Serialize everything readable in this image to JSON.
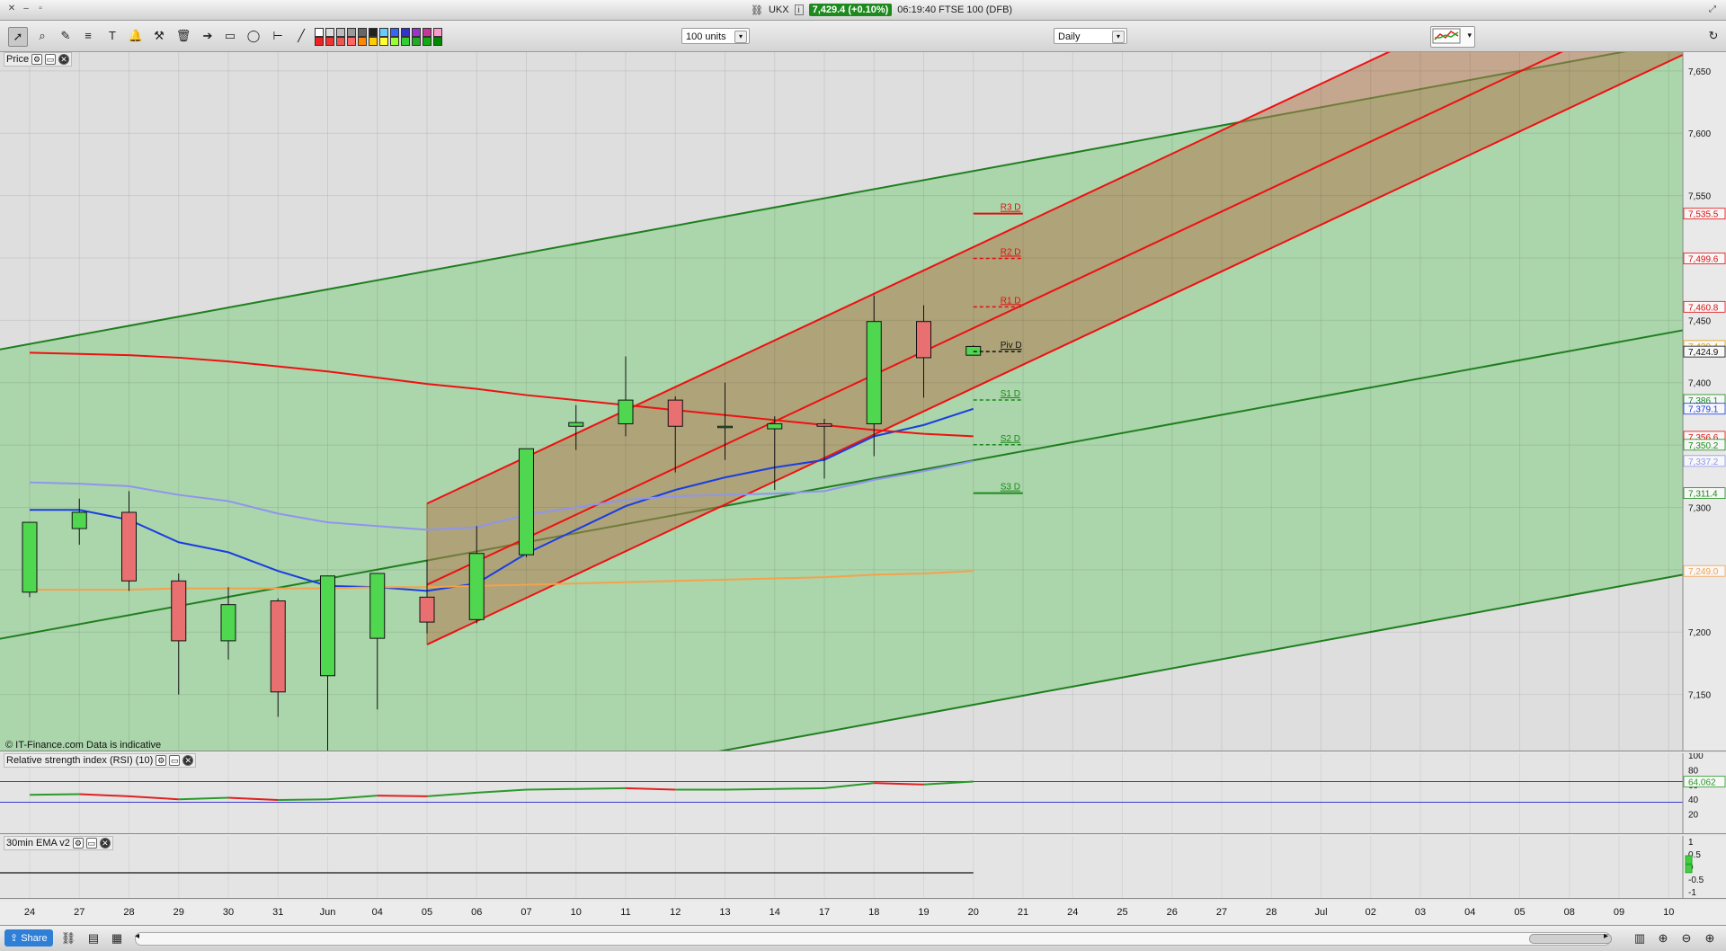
{
  "window": {
    "symbol": "UKX",
    "price_badge": "7,429.4 (+0.10%)",
    "time_and_market": "06:19:40 FTSE 100 (DFB)"
  },
  "toolbar": {
    "units_select": "100 units",
    "interval_select": "Daily"
  },
  "panels": {
    "price_label": "Price",
    "rsi_label": "Relative strength index (RSI) (10)",
    "ema_label": "30min EMA v2",
    "credit": "© IT-Finance.com  Data is indicative"
  },
  "statusbar": {
    "share_label": "Share"
  },
  "colors": {
    "green_channel": "#1f7f1f",
    "red_channel": "#ee1111",
    "ma_blue": "#1a3ee0",
    "ma_lightblue": "#8f95ee",
    "ma_orange": "#f5a24a",
    "up_candle": "#4fd84f",
    "down_candle": "#e87070"
  },
  "chart_data": [
    {
      "type": "candlestick",
      "x_axis_labels": [
        "24",
        "27",
        "28",
        "29",
        "30",
        "31",
        "Jun",
        "04",
        "05",
        "06",
        "07",
        "10",
        "11",
        "12",
        "13",
        "14",
        "17",
        "18",
        "19",
        "20",
        "21",
        "24",
        "25",
        "26",
        "27",
        "28",
        "Jul",
        "02",
        "03",
        "04",
        "05",
        "08",
        "09",
        "10"
      ],
      "y_ticks": [
        "7,650",
        "7,600",
        "7,550",
        "7,500",
        "7,450",
        "7,400",
        "7,350",
        "7,300",
        "7,250",
        "7,200",
        "7,150"
      ],
      "ylim": [
        7105,
        7665
      ],
      "candles": [
        {
          "date": "24",
          "open": 7232,
          "high": 7282,
          "low": 7228,
          "close": 7288
        },
        {
          "date": "27",
          "open": 7283,
          "high": 7307,
          "low": 7270,
          "close": 7296
        },
        {
          "date": "28",
          "open": 7296,
          "high": 7313,
          "low": 7233,
          "close": 7241
        },
        {
          "date": "29",
          "open": 7241,
          "high": 7247,
          "low": 7150,
          "close": 7193
        },
        {
          "date": "30",
          "open": 7193,
          "high": 7236,
          "low": 7178,
          "close": 7222
        },
        {
          "date": "31",
          "open": 7225,
          "high": 7227,
          "low": 7132,
          "close": 7152
        },
        {
          "date": "Jun",
          "open": 7165,
          "high": 7190,
          "low": 7100,
          "close": 7245
        },
        {
          "date": "04",
          "open": 7195,
          "high": 7240,
          "low": 7138,
          "close": 7247
        },
        {
          "date": "05",
          "open": 7228,
          "high": 7258,
          "low": 7199,
          "close": 7208
        },
        {
          "date": "06",
          "open": 7210,
          "high": 7285,
          "low": 7207,
          "close": 7263
        },
        {
          "date": "07",
          "open": 7262,
          "high": 7347,
          "low": 7260,
          "close": 7347
        },
        {
          "date": "10",
          "open": 7365,
          "high": 7382,
          "low": 7346,
          "close": 7368
        },
        {
          "date": "11",
          "open": 7367,
          "high": 7421,
          "low": 7357,
          "close": 7386
        },
        {
          "date": "12",
          "open": 7386,
          "high": 7389,
          "low": 7328,
          "close": 7365
        },
        {
          "date": "13",
          "open": 7365,
          "high": 7400,
          "low": 7338,
          "close": 7365
        },
        {
          "date": "14",
          "open": 7363,
          "high": 7373,
          "low": 7314,
          "close": 7367
        },
        {
          "date": "17",
          "open": 7367,
          "high": 7371,
          "low": 7323,
          "close": 7365
        },
        {
          "date": "18",
          "open": 7367,
          "high": 7470,
          "low": 7341,
          "close": 7449
        },
        {
          "date": "19",
          "open": 7449,
          "high": 7462,
          "low": 7388,
          "close": 7420
        },
        {
          "date": "20",
          "open": 7422,
          "high": 7430,
          "low": 7422,
          "close": 7429
        }
      ],
      "pivot_levels": [
        {
          "name": "R3 D",
          "value": 7535.5
        },
        {
          "name": "R2 D",
          "value": 7499.6
        },
        {
          "name": "R1 D",
          "value": 7460.8
        },
        {
          "name": "Piv D",
          "value": 7424.9
        },
        {
          "name": "S1 D",
          "value": 7386.1
        },
        {
          "name": "S2 D",
          "value": 7350.2
        },
        {
          "name": "S3 D",
          "value": 7311.4
        }
      ],
      "right_axis_tags": [
        {
          "label": "7,535.5",
          "color": "#e01010"
        },
        {
          "label": "7,499.6",
          "color": "#e01010"
        },
        {
          "label": "7,460.8",
          "color": "#e01010"
        },
        {
          "label": "7,429.4",
          "color": "#e0a000"
        },
        {
          "label": "7,424.9",
          "color": "#111111"
        },
        {
          "label": "7,386.1",
          "color": "#1a8a1a"
        },
        {
          "label": "7,379.1",
          "color": "#1a3ee0"
        },
        {
          "label": "7,356.6",
          "color": "#e01010"
        },
        {
          "label": "7,350.2",
          "color": "#1a8a1a"
        },
        {
          "label": "7,337.2",
          "color": "#8f95ee"
        },
        {
          "label": "7,311.4",
          "color": "#1a8a1a"
        },
        {
          "label": "7,249.0",
          "color": "#f5a24a"
        }
      ],
      "moving_averages": [
        {
          "color": "ma_blue",
          "values": [
            7298,
            7298,
            7290,
            7272,
            7264,
            7249,
            7237,
            7236,
            7233,
            7239,
            7263,
            7282,
            7301,
            7314,
            7324,
            7332,
            7338,
            7357,
            7366,
            7379
          ]
        },
        {
          "color": "ma_lightblue",
          "values": [
            7320,
            7319,
            7317,
            7310,
            7305,
            7295,
            7288,
            7285,
            7282,
            7284,
            7294,
            7300,
            7306,
            7309,
            7310,
            7311,
            7313,
            7322,
            7329,
            7337
          ]
        },
        {
          "color": "ma_orange",
          "values": [
            7234,
            7234,
            7234,
            7235,
            7235,
            7235,
            7235,
            7236,
            7236,
            7237,
            7238,
            7239,
            7240,
            7241,
            7242,
            7243,
            7244,
            7246,
            7247,
            7249
          ]
        },
        {
          "color": "red_channel",
          "values": [
            7424,
            7423,
            7422,
            7420,
            7417,
            7413,
            7409,
            7404,
            7399,
            7395,
            7390,
            7386,
            7382,
            7378,
            7374,
            7370,
            7366,
            7362,
            7359,
            7357
          ]
        }
      ]
    },
    {
      "type": "line",
      "name": "RSI (10)",
      "y_ticks": [
        "100",
        "80",
        "60",
        "40",
        "20"
      ],
      "ylim": [
        0,
        100
      ],
      "bands": [
        64,
        36
      ],
      "last_value_label": "64.062",
      "values": [
        46,
        47,
        44,
        40,
        42,
        39,
        40,
        45,
        44,
        49,
        53,
        54,
        55,
        53,
        53,
        54,
        55,
        62,
        60,
        64
      ]
    },
    {
      "type": "line",
      "name": "30min EMA v2",
      "y_ticks": [
        "1",
        "0.5",
        "0",
        "-0.5",
        "-1"
      ],
      "ylim": [
        -1,
        1
      ]
    }
  ]
}
